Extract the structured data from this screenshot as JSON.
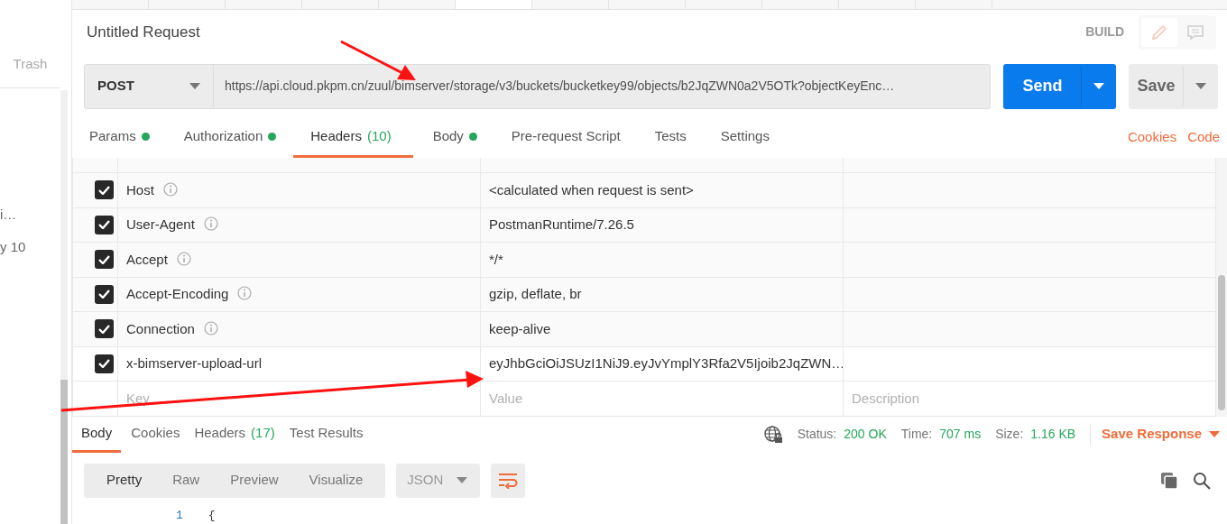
{
  "sidebar": {
    "items": [
      {
        "label": "Trash"
      },
      {
        "label": "i…"
      },
      {
        "label": "y 10"
      }
    ]
  },
  "request": {
    "title": "Untitled Request",
    "mode": "BUILD",
    "method": "POST",
    "url": "https://api.cloud.pkpm.cn/zuul/bimserver/storage/v3/buckets/bucketkey99/objects/b2JqZWN0a2V5OTk?objectKeyEnc…",
    "send": "Send",
    "save": "Save"
  },
  "tabs": [
    {
      "label": "Params",
      "dot": true,
      "selected": false
    },
    {
      "label": "Authorization",
      "dot": true,
      "selected": false
    },
    {
      "label": "Headers",
      "count": "(10)",
      "dot": false,
      "selected": true
    },
    {
      "label": "Body",
      "dot": true,
      "selected": false
    },
    {
      "label": "Pre-request Script",
      "dot": false,
      "selected": false
    },
    {
      "label": "Tests",
      "dot": false,
      "selected": false
    },
    {
      "label": "Settings",
      "dot": false,
      "selected": false
    }
  ],
  "links": [
    "Cookies",
    "Code"
  ],
  "headers": {
    "rows": [
      {
        "checked": true,
        "key": "Host",
        "info": true,
        "value": "<calculated when request is sent>"
      },
      {
        "checked": true,
        "key": "User-Agent",
        "info": true,
        "value": "PostmanRuntime/7.26.5"
      },
      {
        "checked": true,
        "key": "Accept",
        "info": true,
        "value": "*/*"
      },
      {
        "checked": true,
        "key": "Accept-Encoding",
        "info": true,
        "value": "gzip, deflate, br"
      },
      {
        "checked": true,
        "key": "Connection",
        "info": true,
        "value": "keep-alive"
      },
      {
        "checked": true,
        "key": "x-bimserver-upload-url",
        "info": false,
        "value": "eyJhbGciOiJSUzI1NiJ9.eyJvYmplY3Rfa2V5Ijoib2JqZWN…"
      }
    ],
    "new_row": {
      "key_placeholder": "Key",
      "value_placeholder": "Value",
      "description_placeholder": "Description"
    }
  },
  "response": {
    "tabs": [
      {
        "label": "Body",
        "selected": true
      },
      {
        "label": "Cookies",
        "selected": false
      },
      {
        "label": "Headers",
        "count": "(17)",
        "selected": false
      },
      {
        "label": "Test Results",
        "selected": false
      }
    ],
    "stats": [
      {
        "label": "Status:",
        "value": "200 OK"
      },
      {
        "label": "Time:",
        "value": "707 ms"
      },
      {
        "label": "Size:",
        "value": "1.16 KB"
      }
    ],
    "save": "Save Response",
    "view_modes": [
      {
        "label": "Pretty",
        "selected": true
      },
      {
        "label": "Raw",
        "selected": false
      },
      {
        "label": "Preview",
        "selected": false
      },
      {
        "label": "Visualize",
        "selected": false
      }
    ],
    "format": "JSON",
    "lines": [
      {
        "number": "1",
        "text": "{"
      }
    ]
  }
}
